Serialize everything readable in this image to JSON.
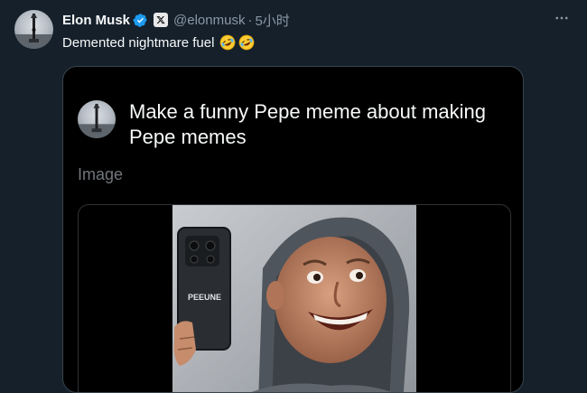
{
  "tweet": {
    "author_name": "Elon Musk",
    "handle": "@elonmusk",
    "separator": "·",
    "time": "5小时",
    "text": "Demented nightmare fuel",
    "emoji": [
      "rolling-on-floor-laughing",
      "rolling-on-floor-laughing"
    ]
  },
  "quote": {
    "prompt": "Make a funny Pepe meme about making Pepe memes",
    "media_label": "Image",
    "phone_text": "PEEUNE"
  },
  "colors": {
    "background": "#15202b",
    "card": "#000000",
    "verified": "#1d9bf0",
    "muted": "#8b98a5"
  }
}
